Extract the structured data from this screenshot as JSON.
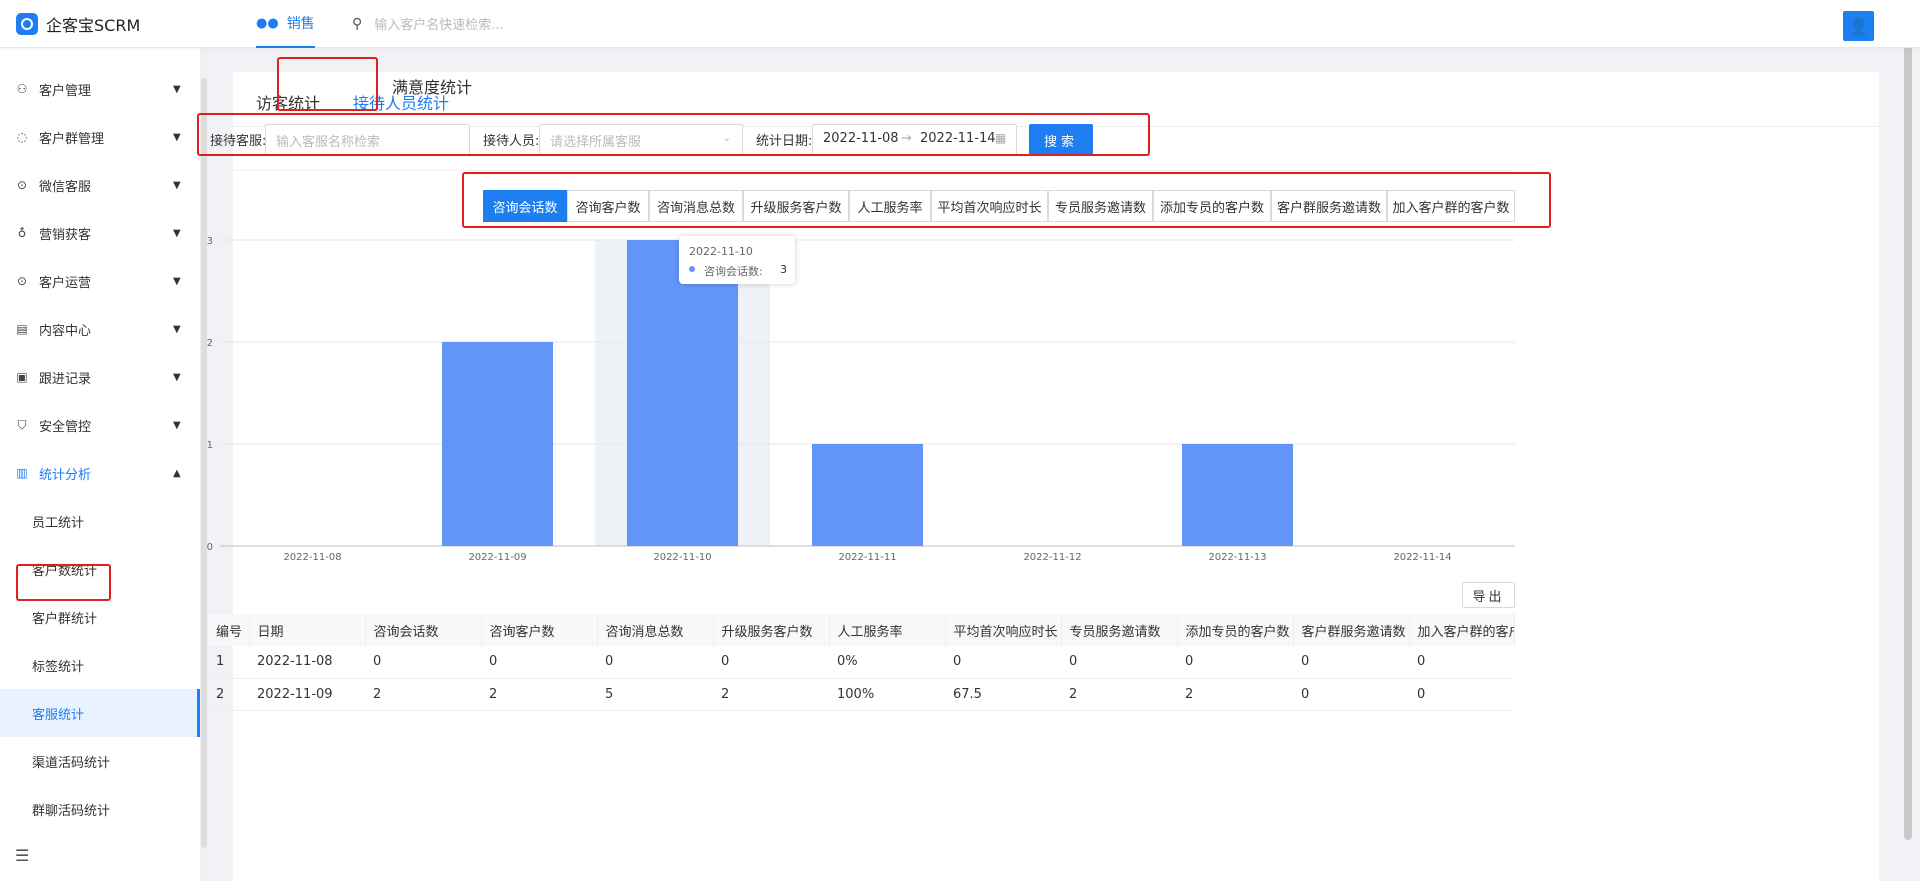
{
  "app": {
    "title": "企客宝SCRM"
  },
  "topnav": {
    "active": "销售",
    "search_placeholder": "输入客户名快速检索..."
  },
  "sidebar": {
    "items": [
      {
        "label": "客户管理",
        "icon": "customer-icon"
      },
      {
        "label": "客户群管理",
        "icon": "group-chat-icon"
      },
      {
        "label": "微信客服",
        "icon": "chat-icon"
      },
      {
        "label": "营销获客",
        "icon": "bulb-icon"
      },
      {
        "label": "客户运营",
        "icon": "chat-icon"
      },
      {
        "label": "内容中心",
        "icon": "content-icon"
      },
      {
        "label": "跟进记录",
        "icon": "record-icon"
      },
      {
        "label": "安全管控",
        "icon": "shield-icon"
      },
      {
        "label": "统计分析",
        "icon": "chart-icon"
      }
    ],
    "subitems": [
      "员工统计",
      "客户数统计",
      "客户群统计",
      "标签统计",
      "客服统计",
      "渠道活码统计",
      "群聊活码统计"
    ]
  },
  "tabs": [
    "访客统计",
    "接待人员统计",
    "满意度统计"
  ],
  "filters": {
    "service_label": "接待客服:",
    "service_placeholder": "输入客服名称检索",
    "staff_label": "接待人员:",
    "staff_placeholder": "请选择所属客服",
    "date_label": "统计日期:",
    "date_start": "2022-11-08",
    "date_sep": "→",
    "date_end": "2022-11-14",
    "search_button": "搜索"
  },
  "metric_tabs": [
    "咨询会话数",
    "咨询客户数",
    "咨询消息总数",
    "升级服务客户数",
    "人工服务率",
    "平均首次响应时长",
    "专员服务邀请数",
    "添加专员的客户数",
    "客户群服务邀请数",
    "加入客户群的客户数"
  ],
  "chart_data": {
    "type": "bar",
    "categories": [
      "2022-11-08",
      "2022-11-09",
      "2022-11-10",
      "2022-11-11",
      "2022-11-12",
      "2022-11-13",
      "2022-11-14"
    ],
    "series": [
      {
        "name": "咨询会话数",
        "values": [
          0,
          2,
          3,
          1,
          0,
          1,
          0
        ]
      }
    ],
    "ylim": [
      0,
      3
    ],
    "yticks": [
      "0",
      "1",
      "2",
      "3"
    ],
    "bar_color": "#6395f9",
    "highlight_index": 2,
    "tooltip": {
      "title": "2022-11-10",
      "label": "咨询会话数:",
      "value": "3"
    }
  },
  "export_button": "导出",
  "table": {
    "columns": [
      "编号",
      "日期",
      "咨询会话数",
      "咨询客户数",
      "咨询消息总数",
      "升级服务客户数",
      "人工服务率",
      "平均首次响应时长",
      "专员服务邀请数",
      "添加专员的客户数",
      "客户群服务邀请数",
      "加入客户群的客户数"
    ],
    "rows": [
      [
        "1",
        "2022-11-08",
        "0",
        "0",
        "0",
        "0",
        "0%",
        "0",
        "0",
        "0",
        "0",
        "0"
      ],
      [
        "2",
        "2022-11-09",
        "2",
        "2",
        "5",
        "2",
        "100%",
        "67.5",
        "2",
        "2",
        "0",
        "0"
      ]
    ]
  },
  "colors": {
    "accent": "#1d7ef2",
    "annotation": "#e02020"
  }
}
